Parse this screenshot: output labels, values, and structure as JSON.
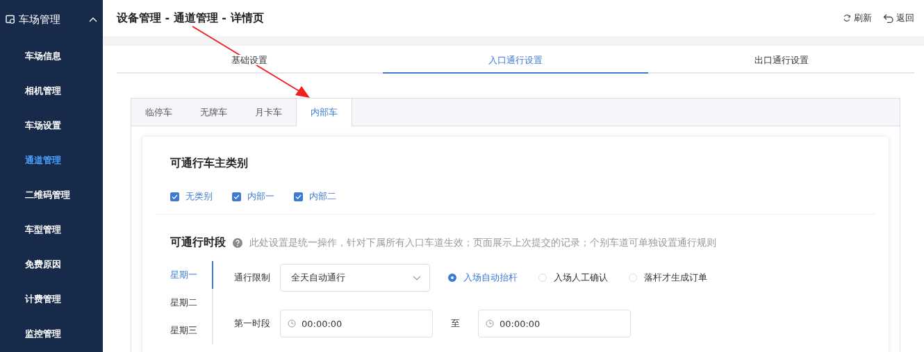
{
  "sidebar": {
    "group": {
      "label": "车场管理",
      "expanded": true
    },
    "items": [
      {
        "label": "车场信息",
        "selected": false
      },
      {
        "label": "相机管理",
        "selected": false
      },
      {
        "label": "车场设置",
        "selected": false
      },
      {
        "label": "通道管理",
        "selected": true
      },
      {
        "label": "二维码管理",
        "selected": false
      },
      {
        "label": "车型管理",
        "selected": false
      },
      {
        "label": "免费原因",
        "selected": false
      },
      {
        "label": "计费管理",
        "selected": false
      },
      {
        "label": "监控管理",
        "selected": false
      }
    ]
  },
  "header": {
    "title": "设备管理 - 通道管理 - 详情页",
    "actions": [
      {
        "kind": "refresh",
        "label": "刷新"
      },
      {
        "kind": "back",
        "label": "返回"
      }
    ]
  },
  "main_tabs": [
    {
      "label": "基础设置",
      "selected": false
    },
    {
      "label": "入口通行设置",
      "selected": true
    },
    {
      "label": "出口通行设置",
      "selected": false
    }
  ],
  "vehicle_tabs": [
    {
      "label": "临停车",
      "selected": false
    },
    {
      "label": "无牌车",
      "selected": false
    },
    {
      "label": "月卡车",
      "selected": false
    },
    {
      "label": "内部车",
      "selected": true
    }
  ],
  "owner_types": {
    "title": "可通行车主类别",
    "options": [
      {
        "label": "无类别",
        "checked": true
      },
      {
        "label": "内部一",
        "checked": true
      },
      {
        "label": "内部二",
        "checked": true
      }
    ]
  },
  "time_rules": {
    "title": "可通行时段",
    "note": "此处设置是统一操作，针对下属所有入口车道生效；页面展示上次提交的记录；个别车道可单独设置通行规则",
    "weekdays": [
      {
        "label": "星期一",
        "selected": true
      },
      {
        "label": "星期二",
        "selected": false
      },
      {
        "label": "星期三",
        "selected": false
      }
    ],
    "restriction": {
      "label": "通行限制",
      "value": "全天自动通行"
    },
    "modes": [
      {
        "label": "入场自动抬杆",
        "selected": true
      },
      {
        "label": "入场人工确认",
        "selected": false
      },
      {
        "label": "落杆才生成订单",
        "selected": false
      }
    ],
    "periods": [
      {
        "label": "第一时段",
        "start": "00:00:00",
        "separator": "至",
        "end": "00:00:00"
      }
    ]
  }
}
